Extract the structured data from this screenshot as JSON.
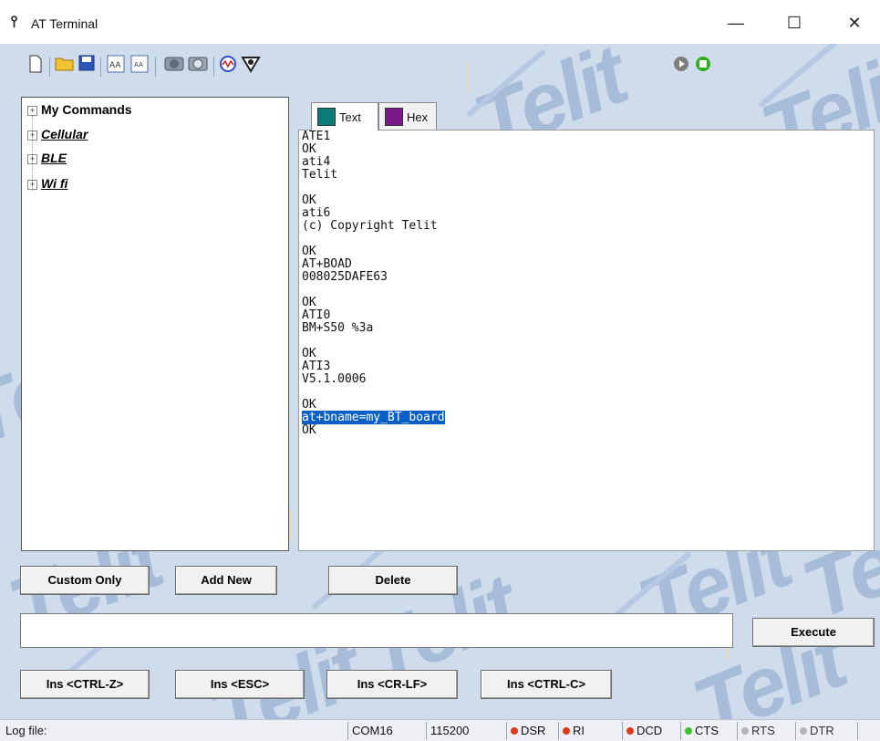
{
  "window": {
    "title": "AT Terminal",
    "app_icon": "antenna-icon",
    "minimize": "—",
    "maximize": "☐",
    "close": "✕"
  },
  "watermark": "Telit",
  "toolbar": {
    "icons": [
      "new-file-icon",
      "open-folder-icon",
      "save-icon",
      "font-larger-icon",
      "font-smaller-icon",
      "connect-icon",
      "disconnect-icon",
      "monitor-icon",
      "settings-icon"
    ],
    "run_icons": [
      "play-icon",
      "stop-icon"
    ]
  },
  "tree": {
    "items": [
      {
        "label": "My Commands",
        "style": "bold"
      },
      {
        "label": "Cellular",
        "style": "italic"
      },
      {
        "label": "BLE",
        "style": "italic"
      },
      {
        "label": "Wi fi",
        "style": "italic"
      }
    ]
  },
  "tabs": {
    "text": {
      "label": "Text",
      "color": "#0f7a7a"
    },
    "hex": {
      "label": "Hex",
      "color": "#7a1a8a"
    }
  },
  "terminal": {
    "lines": [
      "ATE1",
      "OK",
      "ati4",
      "Telit",
      "",
      "OK",
      "ati6",
      "(c) Copyright Telit",
      "",
      "OK",
      "AT+BOAD",
      "008025DAFE63",
      "",
      "OK",
      "ATI0",
      "BM+S50 %3a",
      "",
      "OK",
      "ATI3",
      "V5.1.0006",
      "",
      "OK",
      "at+bname=my_BT_board",
      "OK"
    ],
    "selected_line": "at+bname=my_BT_board"
  },
  "buttons": {
    "custom_only": "Custom Only",
    "add_new": "Add New",
    "delete": "Delete",
    "execute": "Execute",
    "ins_ctrl_z": "Ins <CTRL-Z>",
    "ins_esc": "Ins <ESC>",
    "ins_cr_lf": "Ins <CR-LF>",
    "ins_ctrl_c": "Ins <CTRL-C>"
  },
  "command_input": {
    "value": ""
  },
  "status": {
    "log_file": "Log file:",
    "port": "COM16",
    "baud": "115200",
    "dsr": "DSR",
    "ri": "RI",
    "dcd": "DCD",
    "cts": "CTS",
    "rts": "RTS",
    "dtr": "DTR",
    "colors": {
      "red": "#e03a1a",
      "green": "#3fbf2f",
      "off": "#b5b5b5"
    }
  }
}
